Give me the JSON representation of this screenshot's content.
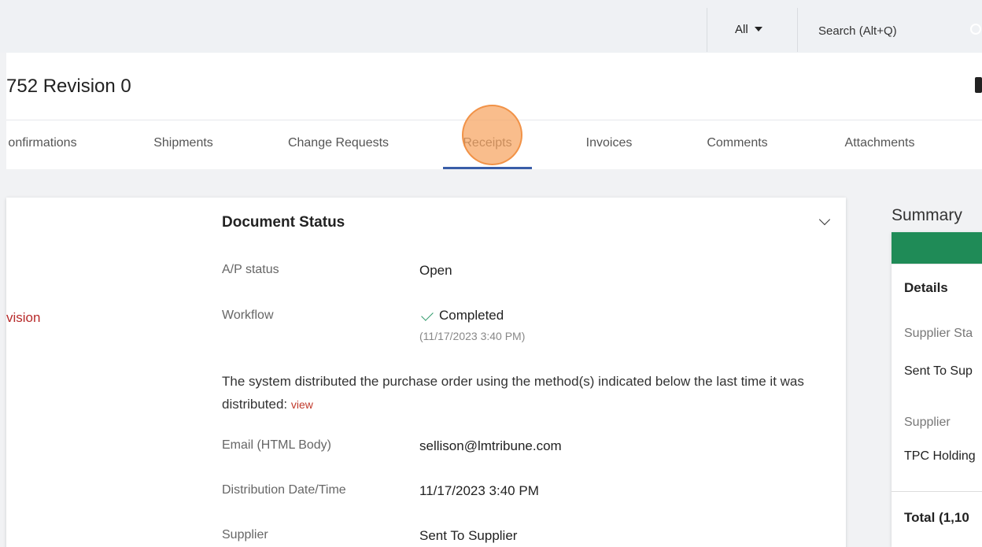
{
  "header": {
    "search_scope": "All",
    "search_placeholder": "Search (Alt+Q)",
    "icons": [
      "search-icon",
      "caret-down-icon"
    ]
  },
  "page": {
    "title": "752 Revision 0",
    "icons": [
      "print-icon"
    ]
  },
  "tabs": [
    {
      "label": "onfirmations"
    },
    {
      "label": "Shipments"
    },
    {
      "label": "Change Requests"
    },
    {
      "label": "Receipts",
      "active": true
    },
    {
      "label": "Invoices"
    },
    {
      "label": "Comments"
    },
    {
      "label": "Attachments"
    }
  ],
  "left_column": {
    "link_text": "vision"
  },
  "document_status": {
    "title": "Document Status",
    "ap_status_label": "A/P status",
    "ap_status_value": "Open",
    "workflow_label": "Workflow",
    "workflow_value": "Completed",
    "workflow_timestamp": "(11/17/2023 3:40 PM)",
    "distribution_text": "The system distributed the purchase order using the method(s) indicated below the last time it was distributed:",
    "view_link": "view",
    "email_label": "Email (HTML Body)",
    "email_value": "sellison@lmtribune.com",
    "distribution_label": "Distribution Date/Time",
    "distribution_value": "11/17/2023 3:40 PM",
    "supplier_label": "Supplier",
    "supplier_value": "Sent To Supplier",
    "icons": [
      "chevron-down-icon",
      "check-icon"
    ]
  },
  "summary": {
    "title": "Summary",
    "details_heading": "Details",
    "supplier_status_label": "Supplier Sta",
    "supplier_status_value": "Sent To Sup",
    "supplier_label": "Supplier",
    "supplier_value": "TPC Holding",
    "total_label": "Total (1,10",
    "accent_color": "#1f8b57"
  },
  "colors": {
    "active_tab": "#3a5ea8",
    "link_red": "#b72a2a",
    "success_green": "#2e9a6a",
    "click_indicator": "#f6a45f"
  }
}
